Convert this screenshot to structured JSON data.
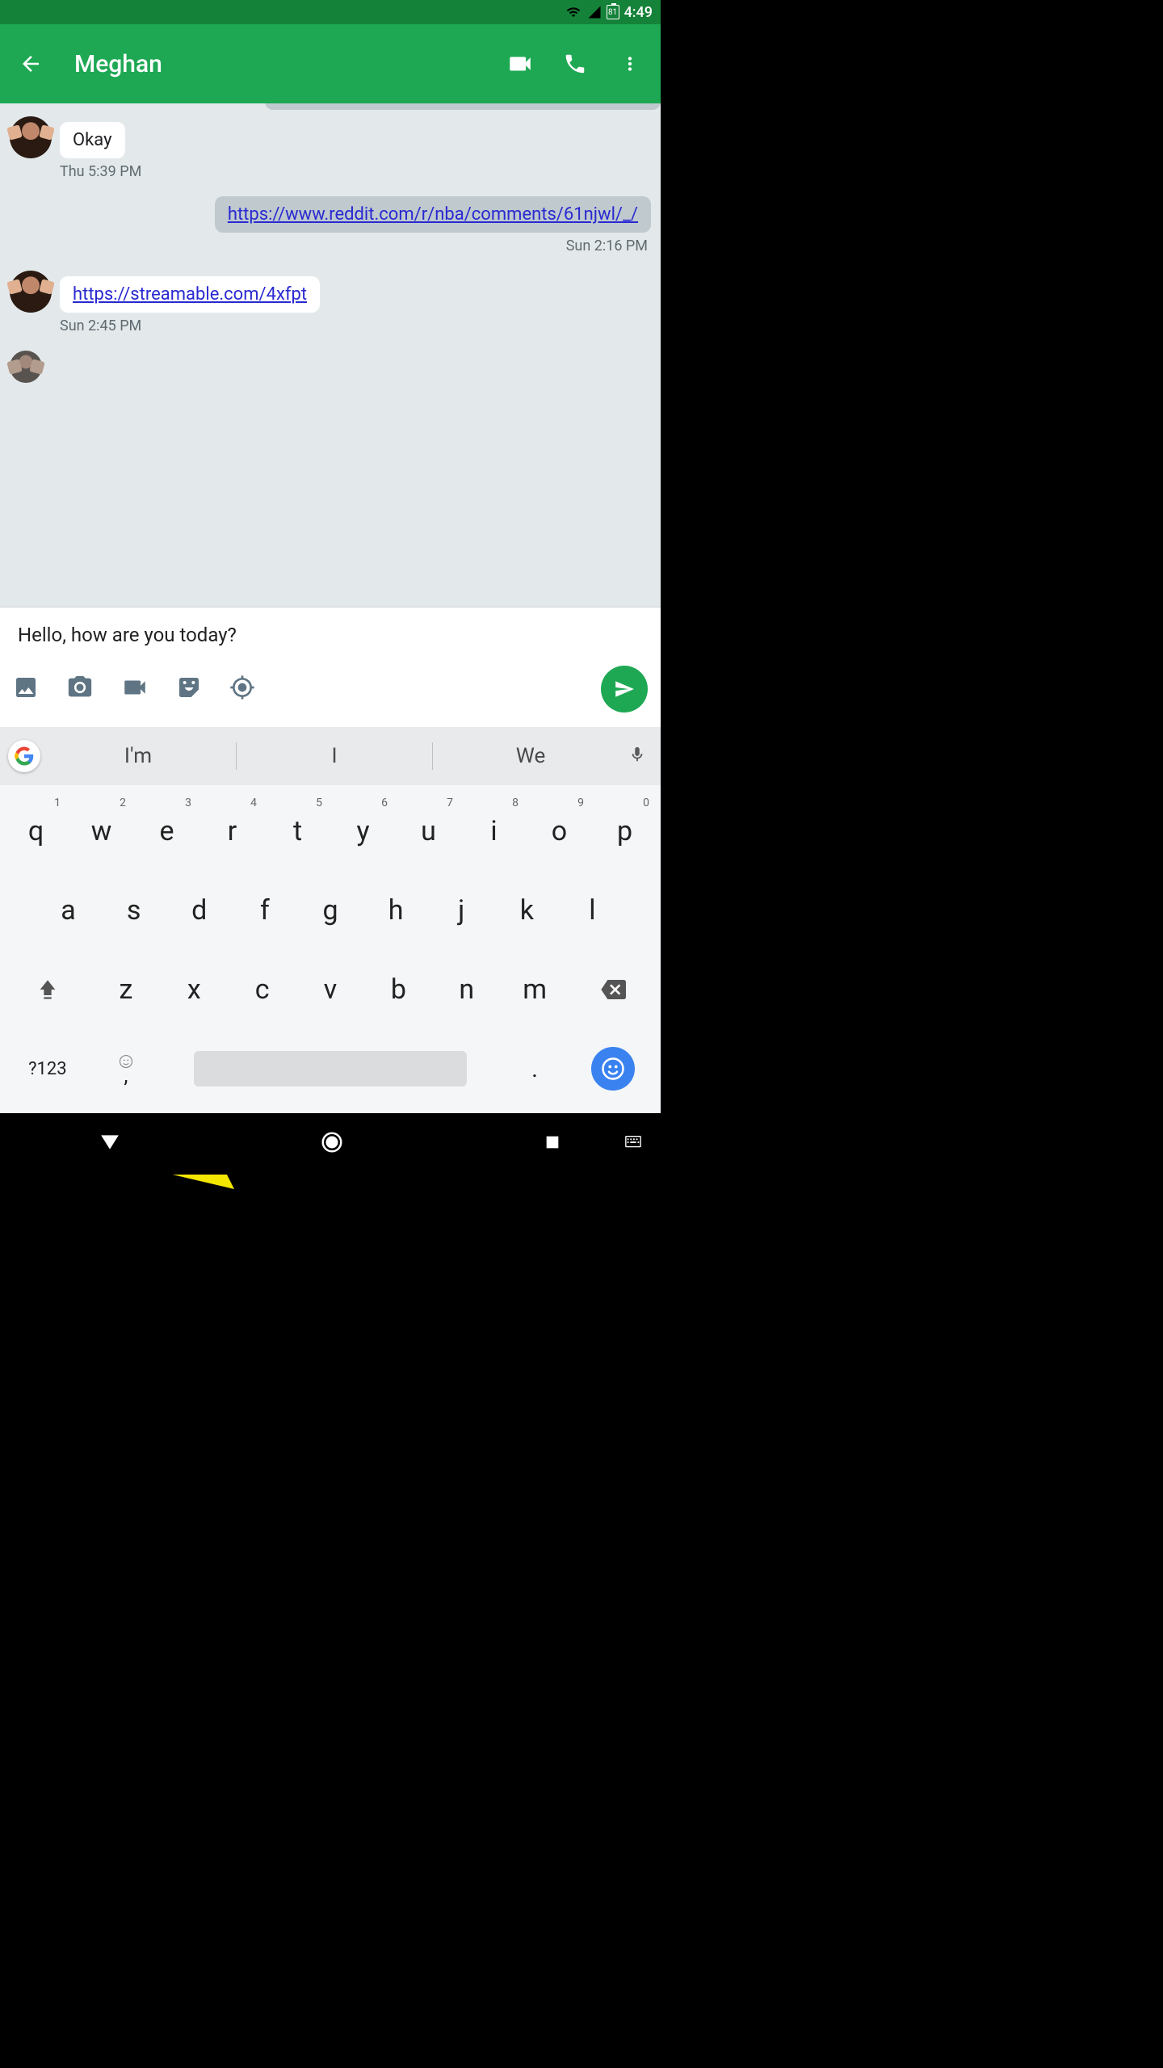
{
  "status": {
    "battery": "81",
    "time": "4:49"
  },
  "header": {
    "contact_name": "Meghan"
  },
  "messages": {
    "m1": {
      "text": "Okay",
      "ts": "Thu 5:39 PM"
    },
    "m2": {
      "text": "https://www.reddit.com/r/nba/comments/61njwl/_/",
      "ts": "Sun 2:16 PM"
    },
    "m3": {
      "text": "https://streamable.com/4xfpt",
      "ts": "Sun 2:45 PM"
    }
  },
  "compose": {
    "draft": "Hello, how are you today?"
  },
  "suggestions": {
    "s1": "I'm",
    "s2": "I",
    "s3": "We"
  },
  "keys": {
    "r1": [
      "q",
      "w",
      "e",
      "r",
      "t",
      "y",
      "u",
      "i",
      "o",
      "p"
    ],
    "r1h": [
      "1",
      "2",
      "3",
      "4",
      "5",
      "6",
      "7",
      "8",
      "9",
      "0"
    ],
    "r2": [
      "a",
      "s",
      "d",
      "f",
      "g",
      "h",
      "j",
      "k",
      "l"
    ],
    "r3": [
      "z",
      "x",
      "c",
      "v",
      "b",
      "n",
      "m"
    ],
    "symkey": "?123",
    "comma": ",",
    "period": "."
  }
}
